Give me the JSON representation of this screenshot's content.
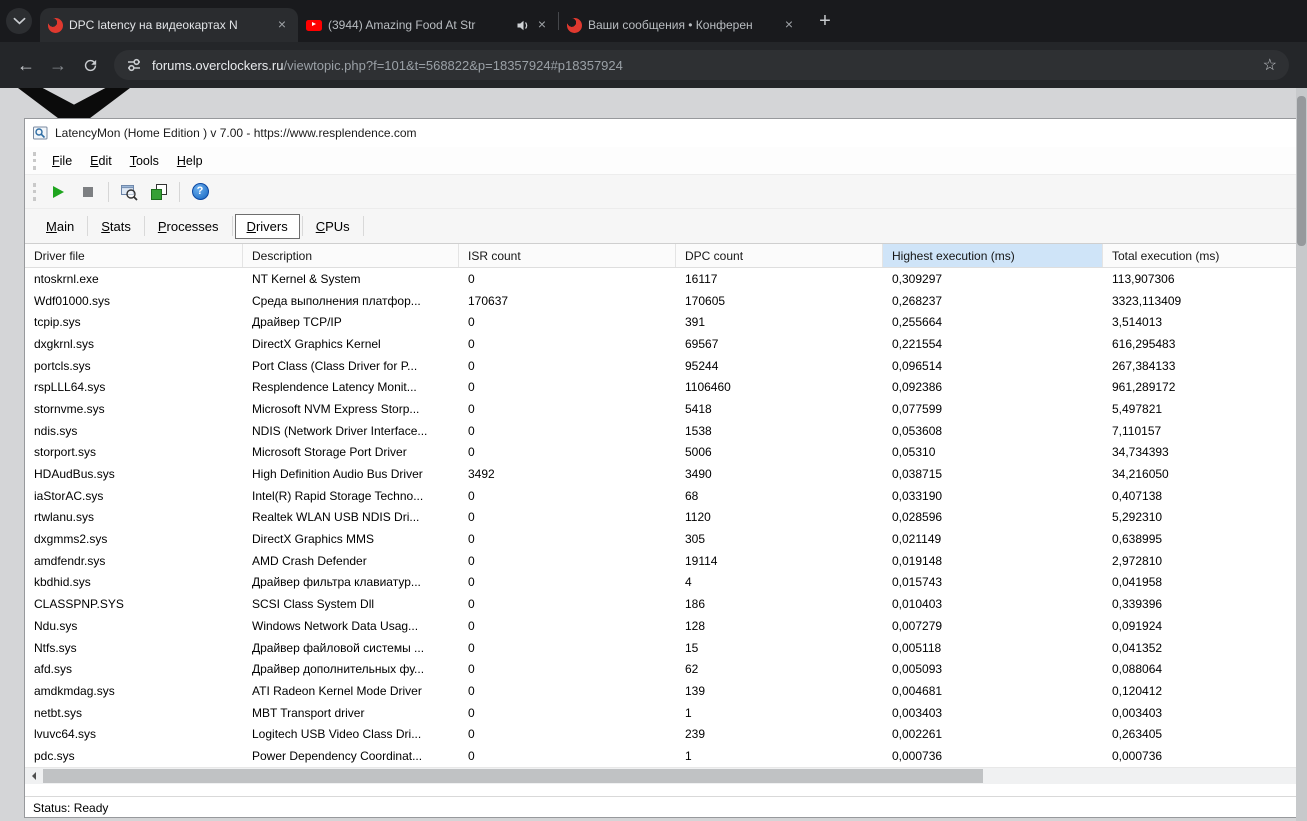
{
  "browser": {
    "tabs": [
      {
        "title": "DPC latency на видеокартах N",
        "favicon": "overclockers-favicon",
        "active": true
      },
      {
        "title": "(3944) Amazing Food At Str",
        "favicon": "youtube-favicon",
        "audio_playing": true
      },
      {
        "title": "Ваши сообщения • Конферен",
        "favicon": "overclockers-favicon",
        "active": false
      }
    ],
    "url_domain": "forums.overclockers.ru",
    "url_path": "/viewtopic.php?f=101&t=568822&p=18357924#p18357924"
  },
  "icons": {
    "close": "×",
    "new_tab": "+",
    "back": "←",
    "forward": "→",
    "star": "☆",
    "help": "?"
  },
  "app": {
    "title": "LatencyMon  (Home Edition )  v 7.00 - https://www.resplendence.com",
    "menu": [
      "File",
      "Edit",
      "Tools",
      "Help"
    ],
    "tabs": [
      "Main",
      "Stats",
      "Processes",
      "Drivers",
      "CPUs"
    ],
    "selected_tab": "Drivers",
    "status": "Status: Ready",
    "table": {
      "columns": [
        "Driver file",
        "Description",
        "ISR count",
        "DPC count",
        "Highest execution (ms)",
        "Total execution (ms)"
      ],
      "highlighted_column": "Highest execution (ms)",
      "rows": [
        [
          "ntoskrnl.exe",
          "NT Kernel & System",
          "0",
          "16117",
          "0,309297",
          "113,907306"
        ],
        [
          "Wdf01000.sys",
          "Среда выполнения платфор...",
          "170637",
          "170605",
          "0,268237",
          "3323,113409"
        ],
        [
          "tcpip.sys",
          "Драйвер TCP/IP",
          "0",
          "391",
          "0,255664",
          "3,514013"
        ],
        [
          "dxgkrnl.sys",
          "DirectX Graphics Kernel",
          "0",
          "69567",
          "0,221554",
          "616,295483"
        ],
        [
          "portcls.sys",
          "Port Class (Class Driver for P...",
          "0",
          "95244",
          "0,096514",
          "267,384133"
        ],
        [
          "rspLLL64.sys",
          "Resplendence Latency Monit...",
          "0",
          "1106460",
          "0,092386",
          "961,289172"
        ],
        [
          "stornvme.sys",
          "Microsoft NVM Express Storp...",
          "0",
          "5418",
          "0,077599",
          "5,497821"
        ],
        [
          "ndis.sys",
          "NDIS (Network Driver Interface...",
          "0",
          "1538",
          "0,053608",
          "7,110157"
        ],
        [
          "storport.sys",
          "Microsoft Storage Port Driver",
          "0",
          "5006",
          "0,05310",
          "34,734393"
        ],
        [
          "HDAudBus.sys",
          "High Definition Audio Bus Driver",
          "3492",
          "3490",
          "0,038715",
          "34,216050"
        ],
        [
          "iaStorAC.sys",
          "Intel(R) Rapid Storage Techno...",
          "0",
          "68",
          "0,033190",
          "0,407138"
        ],
        [
          "rtwlanu.sys",
          "Realtek WLAN USB NDIS Dri...",
          "0",
          "1120",
          "0,028596",
          "5,292310"
        ],
        [
          "dxgmms2.sys",
          "DirectX Graphics MMS",
          "0",
          "305",
          "0,021149",
          "0,638995"
        ],
        [
          "amdfendr.sys",
          "AMD Crash Defender",
          "0",
          "19114",
          "0,019148",
          "2,972810"
        ],
        [
          "kbdhid.sys",
          "Драйвер фильтра клавиатур...",
          "0",
          "4",
          "0,015743",
          "0,041958"
        ],
        [
          "CLASSPNP.SYS",
          "SCSI Class System Dll",
          "0",
          "186",
          "0,010403",
          "0,339396"
        ],
        [
          "Ndu.sys",
          "Windows Network Data Usag...",
          "0",
          "128",
          "0,007279",
          "0,091924"
        ],
        [
          "Ntfs.sys",
          "Драйвер файловой системы ...",
          "0",
          "15",
          "0,005118",
          "0,041352"
        ],
        [
          "afd.sys",
          "Драйвер дополнительных фу...",
          "0",
          "62",
          "0,005093",
          "0,088064"
        ],
        [
          "amdkmdag.sys",
          "ATI Radeon Kernel Mode Driver",
          "0",
          "139",
          "0,004681",
          "0,120412"
        ],
        [
          "netbt.sys",
          "MBT Transport driver",
          "0",
          "1",
          "0,003403",
          "0,003403"
        ],
        [
          "lvuvc64.sys",
          "Logitech USB Video Class Dri...",
          "0",
          "239",
          "0,002261",
          "0,263405"
        ],
        [
          "pdc.sys",
          "Power Dependency Coordinat...",
          "0",
          "1",
          "0,000736",
          "0,000736"
        ]
      ]
    }
  },
  "colors": {
    "header_highlight": "#cfe4f8",
    "youtube_red": "#ff0000",
    "favicon_red": "#e0392f",
    "play_green": "#1fa51f",
    "help_blue": "#1565c0"
  }
}
